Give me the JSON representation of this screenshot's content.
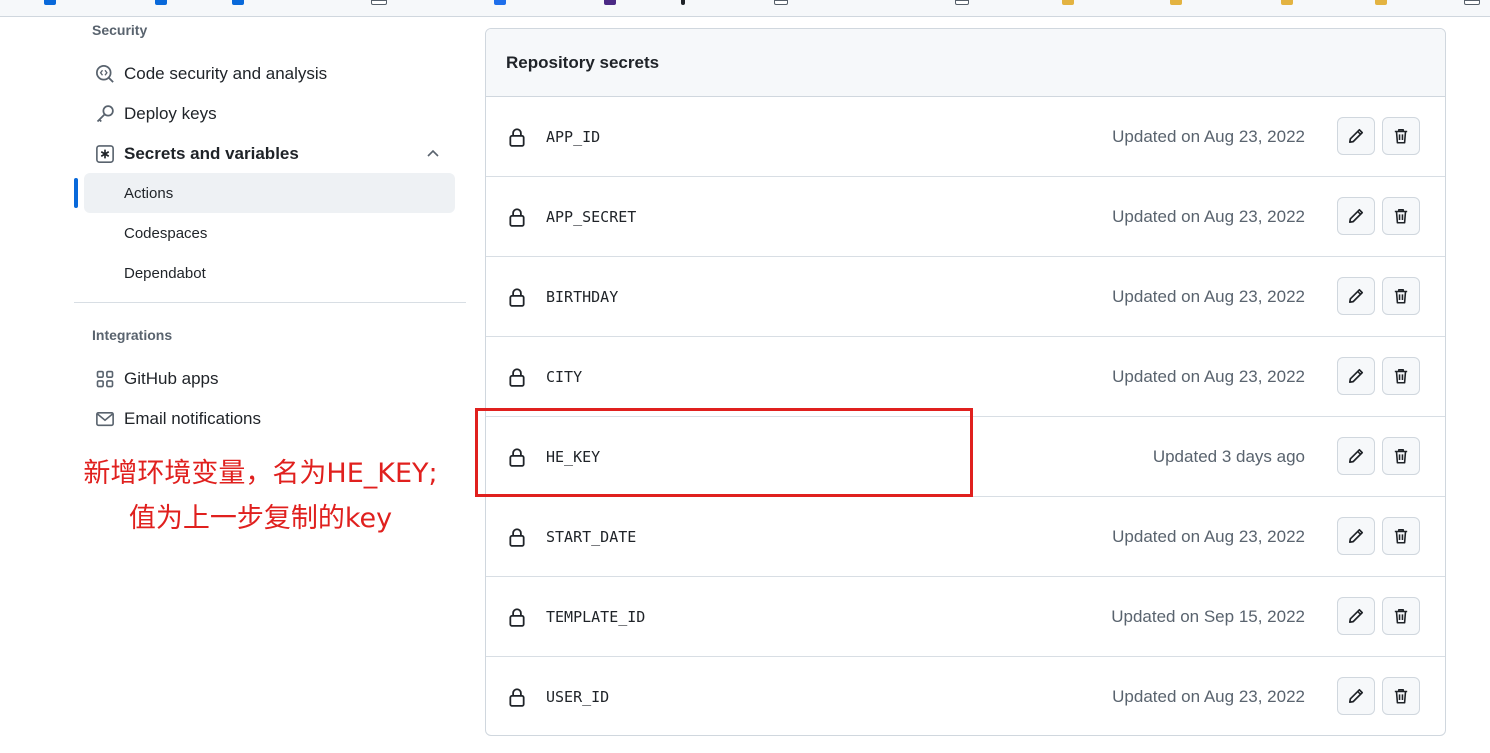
{
  "sidebar": {
    "security_label": "Security",
    "integrations_label": "Integrations",
    "items": [
      {
        "label": "Code security and analysis",
        "icon": "codescan-icon"
      },
      {
        "label": "Deploy keys",
        "icon": "key-icon"
      },
      {
        "label": "Secrets and variables",
        "icon": "asterisk-icon",
        "expanded": true
      },
      {
        "label": "GitHub apps",
        "icon": "apps-icon"
      },
      {
        "label": "Email notifications",
        "icon": "mail-icon"
      }
    ],
    "sub_items": [
      {
        "label": "Actions",
        "active": true
      },
      {
        "label": "Codespaces"
      },
      {
        "label": "Dependabot"
      }
    ]
  },
  "annotation": {
    "line1": "新增环境变量，名为HE_KEY;",
    "line2": "值为上一步复制的key",
    "color": "#e0201e"
  },
  "secrets": {
    "title": "Repository secrets",
    "rows": [
      {
        "name": "APP_ID",
        "updated": "Updated on Aug 23, 2022"
      },
      {
        "name": "APP_SECRET",
        "updated": "Updated on Aug 23, 2022"
      },
      {
        "name": "BIRTHDAY",
        "updated": "Updated on Aug 23, 2022"
      },
      {
        "name": "CITY",
        "updated": "Updated on Aug 23, 2022"
      },
      {
        "name": "HE_KEY",
        "updated": "Updated 3 days ago",
        "highlighted": true
      },
      {
        "name": "START_DATE",
        "updated": "Updated on Aug 23, 2022"
      },
      {
        "name": "TEMPLATE_ID",
        "updated": "Updated on Sep 15, 2022"
      },
      {
        "name": "USER_ID",
        "updated": "Updated on Aug 23, 2022"
      }
    ]
  },
  "colors": {
    "accent": "#0969da",
    "highlight": "#e0201e"
  }
}
